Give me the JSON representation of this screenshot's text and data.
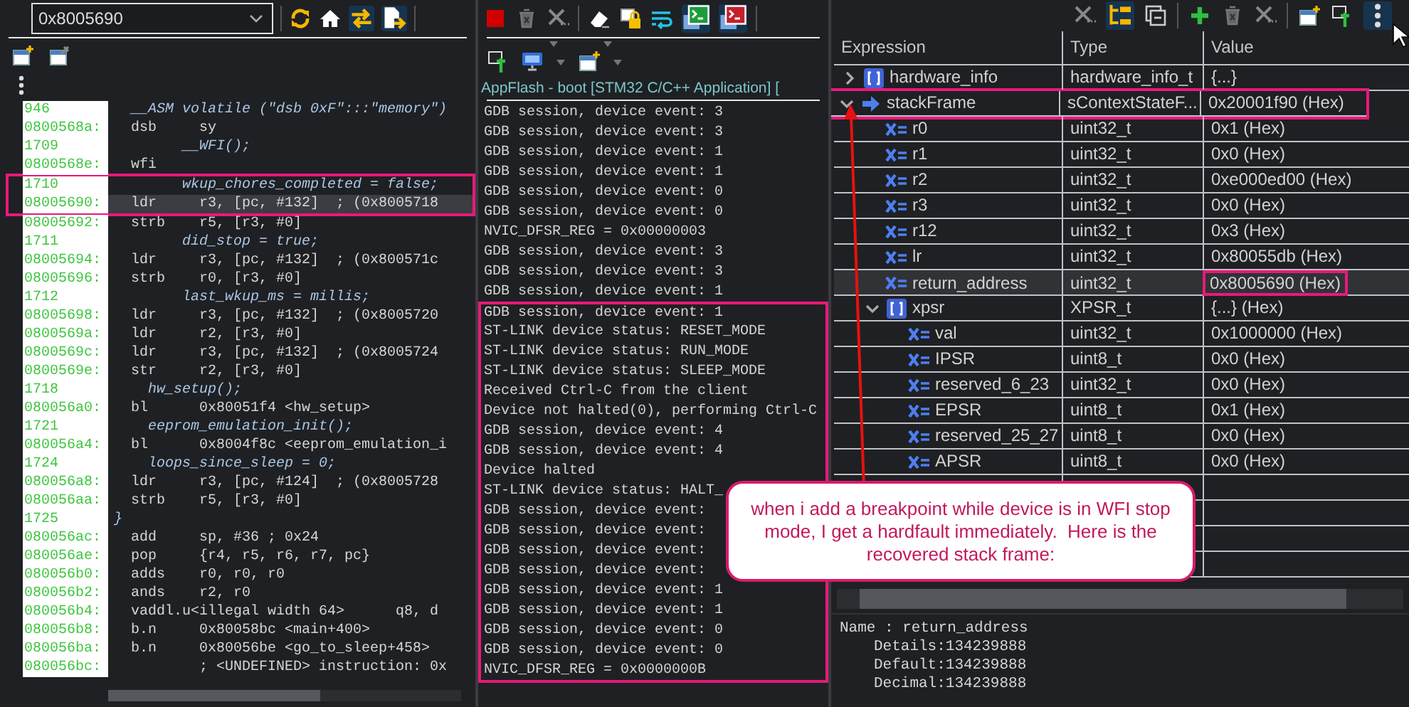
{
  "disassembly": {
    "address_field": {
      "value": "0x8005690"
    },
    "lines": [
      {
        "label": "946",
        "code": "  __ASM volatile (\"dsb 0xF\":::\"memory\")",
        "kind": "source"
      },
      {
        "label": "0800568a:",
        "code": "  dsb     sy",
        "kind": "asm"
      },
      {
        "label": "1709",
        "code": "        __WFI();",
        "kind": "source"
      },
      {
        "label": "0800568e:",
        "code": "  wfi",
        "kind": "asm"
      },
      {
        "label": "1710",
        "code": "        wkup_chores_completed = false;",
        "kind": "source",
        "boxed": true
      },
      {
        "label": "08005690:",
        "code": "  ldr     r3, [pc, #132]  ; (0x8005718",
        "kind": "asm",
        "boxed": true,
        "current": true
      },
      {
        "label": "08005692:",
        "code": "  strb    r5, [r3, #0]",
        "kind": "asm"
      },
      {
        "label": "1711",
        "code": "        did_stop = true;",
        "kind": "source"
      },
      {
        "label": "08005694:",
        "code": "  ldr     r3, [pc, #132]  ; (0x800571c",
        "kind": "asm"
      },
      {
        "label": "08005696:",
        "code": "  strb    r0, [r3, #0]",
        "kind": "asm"
      },
      {
        "label": "1712",
        "code": "        last_wkup_ms = millis;",
        "kind": "source"
      },
      {
        "label": "08005698:",
        "code": "  ldr     r3, [pc, #132]  ; (0x8005720",
        "kind": "asm"
      },
      {
        "label": "0800569a:",
        "code": "  ldr     r2, [r3, #0]",
        "kind": "asm"
      },
      {
        "label": "0800569c:",
        "code": "  ldr     r3, [pc, #132]  ; (0x8005724",
        "kind": "asm"
      },
      {
        "label": "0800569e:",
        "code": "  str     r2, [r3, #0]",
        "kind": "asm"
      },
      {
        "label": "1718",
        "code": "    hw_setup();",
        "kind": "source"
      },
      {
        "label": "080056a0:",
        "code": "  bl      0x80051f4 <hw_setup>",
        "kind": "asm"
      },
      {
        "label": "1721",
        "code": "    eeprom_emulation_init();",
        "kind": "source"
      },
      {
        "label": "080056a4:",
        "code": "  bl      0x8004f8c <eeprom_emulation_i",
        "kind": "asm"
      },
      {
        "label": "1724",
        "code": "    loops_since_sleep = 0;",
        "kind": "source"
      },
      {
        "label": "080056a8:",
        "code": "  ldr     r3, [pc, #124]  ; (0x8005728",
        "kind": "asm"
      },
      {
        "label": "080056aa:",
        "code": "  strb    r5, [r3, #0]",
        "kind": "asm"
      },
      {
        "label": "1725",
        "code": "}",
        "kind": "source"
      },
      {
        "label": "080056ac:",
        "code": "  add     sp, #36 ; 0x24",
        "kind": "asm"
      },
      {
        "label": "080056ae:",
        "code": "  pop     {r4, r5, r6, r7, pc}",
        "kind": "asm"
      },
      {
        "label": "080056b0:",
        "code": "  adds    r0, r0, r0",
        "kind": "asm"
      },
      {
        "label": "080056b2:",
        "code": "  ands    r2, r0",
        "kind": "asm"
      },
      {
        "label": "080056b4:",
        "code": "  vaddl.u<illegal width 64>      q8, d",
        "kind": "asm"
      },
      {
        "label": "080056b8:",
        "code": "  b.n     0x80058bc <main+400>",
        "kind": "asm"
      },
      {
        "label": "080056ba:",
        "code": "  b.n     0x80056be <go_to_sleep+458>",
        "kind": "asm"
      },
      {
        "label": "080056bc:",
        "code": "          ; <UNDEFINED> instruction: 0x",
        "kind": "asm"
      }
    ]
  },
  "console": {
    "title": "AppFlash - boot [STM32 C/C++ Application] [",
    "lines": [
      {
        "text": "GDB session, device event: 3"
      },
      {
        "text": "GDB session, device event: 3"
      },
      {
        "text": "GDB session, device event: 1"
      },
      {
        "text": "GDB session, device event: 1"
      },
      {
        "text": "GDB session, device event: 0"
      },
      {
        "text": "GDB session, device event: 0"
      },
      {
        "text": "NVIC_DFSR_REG = 0x00000003"
      },
      {
        "text": "GDB session, device event: 3"
      },
      {
        "text": "GDB session, device event: 3"
      },
      {
        "text": "GDB session, device event: 1"
      },
      {
        "text": "GDB session, device event: 1",
        "boxed": true
      },
      {
        "text": "ST-LINK device status: RESET_MODE",
        "boxed": true
      },
      {
        "text": "ST-LINK device status: RUN_MODE",
        "boxed": true
      },
      {
        "text": "ST-LINK device status: SLEEP_MODE",
        "boxed": true
      },
      {
        "text": "Received Ctrl-C from the client",
        "boxed": true
      },
      {
        "text": "Device not halted(0), performing Ctrl-C",
        "boxed": true
      },
      {
        "text": "GDB session, device event: 4",
        "boxed": true
      },
      {
        "text": "GDB session, device event: 4",
        "boxed": true
      },
      {
        "text": "Device halted",
        "boxed": true
      },
      {
        "text": "ST-LINK device status: HALT_",
        "boxed": true
      },
      {
        "text": "GDB session, device event:",
        "boxed": true
      },
      {
        "text": "GDB session, device event:",
        "boxed": true
      },
      {
        "text": "GDB session, device event:",
        "boxed": true
      },
      {
        "text": "GDB session, device event:",
        "boxed": true
      },
      {
        "text": "GDB session, device event: 1",
        "boxed": true
      },
      {
        "text": "GDB session, device event: 1",
        "boxed": true
      },
      {
        "text": "GDB session, device event: 0",
        "boxed": true
      },
      {
        "text": "GDB session, device event: 0",
        "boxed": true
      },
      {
        "text": "NVIC_DFSR_REG = 0x0000000B",
        "boxed": true
      }
    ]
  },
  "expressions": {
    "columns": [
      "Expression",
      "Type",
      "Value"
    ],
    "rows": [
      {
        "name": "hardware_info",
        "type": "hardware_info_t",
        "value": "{...}",
        "kind": "struct",
        "expanded": false,
        "selected": false
      },
      {
        "name": "stackFrame",
        "type": "sContextStateF...",
        "value": "0x20001f90 (Hex)",
        "kind": "pointer",
        "expanded": true,
        "selected": false,
        "boxed": true,
        "children": [
          {
            "name": "r0",
            "type": "uint32_t",
            "value": "0x1 (Hex)",
            "kind": "variable",
            "selected": false
          },
          {
            "name": "r1",
            "type": "uint32_t",
            "value": "0x0 (Hex)",
            "kind": "variable",
            "selected": false
          },
          {
            "name": "r2",
            "type": "uint32_t",
            "value": "0xe000ed00 (Hex)",
            "kind": "variable",
            "selected": false
          },
          {
            "name": "r3",
            "type": "uint32_t",
            "value": "0x0 (Hex)",
            "kind": "variable",
            "selected": false
          },
          {
            "name": "r12",
            "type": "uint32_t",
            "value": "0x3 (Hex)",
            "kind": "variable",
            "selected": false
          },
          {
            "name": "lr",
            "type": "uint32_t",
            "value": "0x80055db (Hex)",
            "kind": "variable",
            "selected": false
          },
          {
            "name": "return_address",
            "type": "uint32_t",
            "value": "0x8005690 (Hex)",
            "kind": "variable",
            "selected": true,
            "value_boxed": true
          },
          {
            "name": "xpsr",
            "type": "XPSR_t",
            "value": "{...} (Hex)",
            "kind": "struct",
            "expanded": true,
            "selected": false,
            "children": [
              {
                "name": "val",
                "type": "uint32_t",
                "value": "0x1000000 (Hex)",
                "kind": "variable",
                "selected": false
              },
              {
                "name": "IPSR",
                "type": "uint8_t",
                "value": "0x0 (Hex)",
                "kind": "variable",
                "selected": false
              },
              {
                "name": "reserved_6_23",
                "type": "uint32_t",
                "value": "0x0 (Hex)",
                "kind": "variable",
                "selected": false
              },
              {
                "name": "EPSR",
                "type": "uint8_t",
                "value": "0x1 (Hex)",
                "kind": "variable",
                "selected": false
              },
              {
                "name": "reserved_25_27",
                "type": "uint8_t",
                "value": "0x0 (Hex)",
                "kind": "variable",
                "selected": false
              },
              {
                "name": "APSR",
                "type": "uint8_t",
                "value": "0x0 (Hex)",
                "kind": "variable",
                "selected": false
              }
            ]
          }
        ]
      }
    ],
    "details": [
      {
        "text": "Name : return_address",
        "kind": "header"
      },
      {
        "text": "Details:134239888",
        "kind": "field"
      },
      {
        "text": "Default:134239888",
        "kind": "field"
      },
      {
        "text": "Decimal:134239888",
        "kind": "field"
      }
    ]
  },
  "callout": {
    "text": "when i add a breakpoint while device is in WFI stop mode, I get a hardfault immediately.  Here is the recovered stack frame:"
  }
}
